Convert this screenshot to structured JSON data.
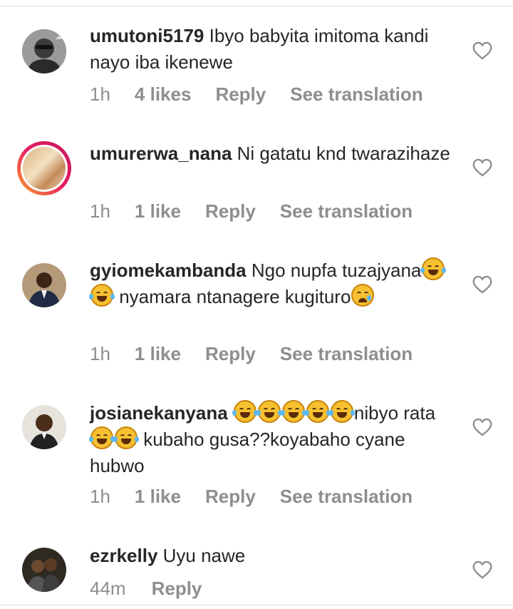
{
  "comments": [
    {
      "username": "umutoni5179",
      "text": "Ibyo babyita imitoma kandi nayo iba ikenewe",
      "time": "1h",
      "likes": "4 likes",
      "reply": "Reply",
      "translate": "See translation",
      "avatar": "avatar-photo-sunglasses"
    },
    {
      "username": "umurerwa_nana",
      "text": "Ni gatatu knd twarazihaze",
      "time": "1h",
      "likes": "1 like",
      "reply": "Reply",
      "translate": "See translation",
      "avatar": "avatar-story-ring"
    },
    {
      "username": "gyiomekambanda",
      "text_parts": [
        "Ngo nupfa tuzajyana",
        " nyamara ntanagere kugituro"
      ],
      "time": "1h",
      "likes": "1 like",
      "reply": "Reply",
      "translate": "See translation",
      "avatar": "avatar-photo-suit"
    },
    {
      "username": "josianekanyana",
      "text_parts": [
        "nibyo rata",
        " kubaho gusa??koyabaho cyane hubwo"
      ],
      "time": "1h",
      "likes": "1 like",
      "reply": "Reply",
      "translate": "See translation",
      "avatar": "avatar-photo-man"
    },
    {
      "username": "ezrkelly",
      "text": "Uyu nawe",
      "time": "44m",
      "reply": "Reply",
      "avatar": "avatar-photo-group"
    }
  ],
  "icons": {
    "like": "heart-outline-icon",
    "emoji_laugh": "face-with-tears-of-joy",
    "emoji_sad": "sad-face"
  },
  "colors": {
    "text": "#262626",
    "meta": "#8e8e8e",
    "story_ring_start": "#f9a825",
    "story_ring_end": "#c2185b"
  }
}
